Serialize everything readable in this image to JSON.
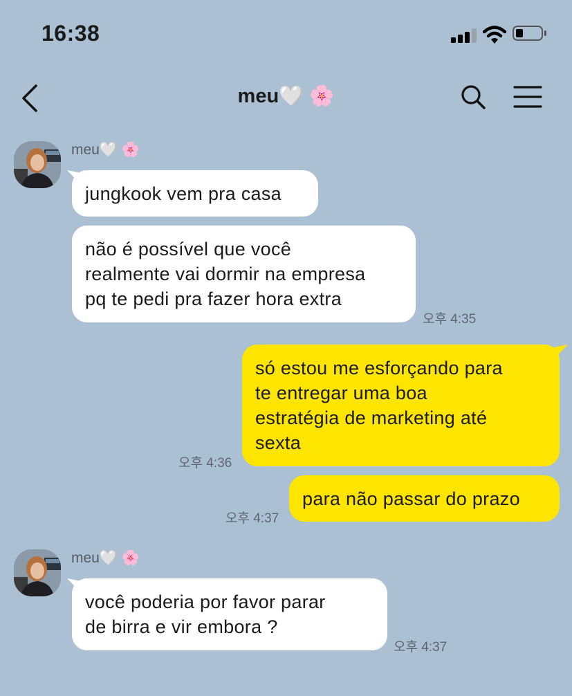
{
  "status_bar": {
    "time": "16:38",
    "battery_level": 0.3
  },
  "header": {
    "title": "meu🤍 🌸",
    "back_icon": "chevron-left-icon",
    "search_icon": "search-icon",
    "menu_icon": "hamburger-menu-icon"
  },
  "chat": {
    "sender_name": "meu🤍 🌸",
    "messages": [
      {
        "text": "jungkook vem pra casa"
      },
      {
        "text": "não é possível que você\nrealmente vai dormir na empresa\npq te pedi pra fazer hora extra",
        "time": "오후 4:35"
      },
      {
        "text": "só estou me esforçando para\nte entregar uma boa\nestratégia de marketing até\nsexta",
        "time": "오후 4:36"
      },
      {
        "text": "para não passar do prazo",
        "time": "오후 4:37"
      },
      {
        "text": "você poderia por favor parar\nde birra e vir embora ?",
        "time": "오후 4:37"
      }
    ]
  },
  "colors": {
    "background": "#abc1d3",
    "outgoing_bubble": "#fee500",
    "incoming_bubble": "#ffffff"
  }
}
